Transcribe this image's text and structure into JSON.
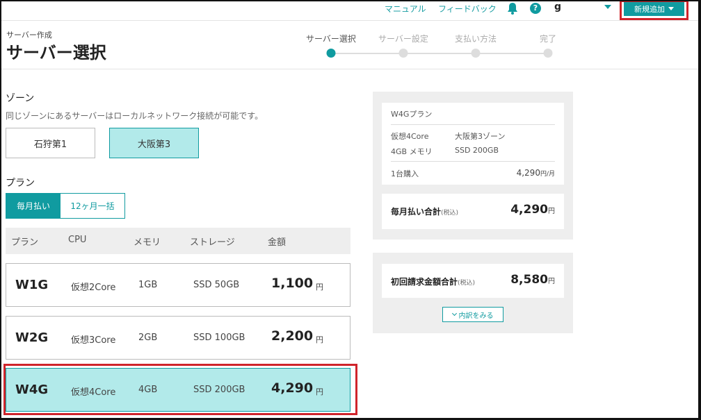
{
  "topbar": {
    "manual": "マニュアル",
    "feedback": "フィードバック",
    "help_glyph": "?",
    "user": "g",
    "new_button": "新規追加"
  },
  "header": {
    "breadcrumb": "サーバー作成",
    "title": "サーバー選択",
    "steps": [
      {
        "label": "サーバー選択",
        "active": true
      },
      {
        "label": "サーバー設定",
        "active": false
      },
      {
        "label": "支払い方法",
        "active": false
      },
      {
        "label": "完了",
        "active": false
      }
    ]
  },
  "zone": {
    "title": "ゾーン",
    "description": "同じゾーンにあるサーバーはローカルネットワーク接続が可能です。",
    "options": [
      "石狩第1",
      "大阪第3"
    ],
    "selected": "大阪第3"
  },
  "plan": {
    "title": "プラン",
    "billing_options": [
      "毎月払い",
      "12ヶ月一括"
    ],
    "billing_selected": "毎月払い",
    "columns": [
      "プラン",
      "CPU",
      "メモリ",
      "ストレージ",
      "金額"
    ],
    "rows": [
      {
        "name": "W1G",
        "cpu": "仮想2Core",
        "memory": "1GB",
        "storage": "SSD 50GB",
        "price": "1,100",
        "unit": "円"
      },
      {
        "name": "W2G",
        "cpu": "仮想3Core",
        "memory": "2GB",
        "storage": "SSD 100GB",
        "price": "2,200",
        "unit": "円"
      },
      {
        "name": "W4G",
        "cpu": "仮想4Core",
        "memory": "4GB",
        "storage": "SSD 200GB",
        "price": "4,290",
        "unit": "円"
      }
    ],
    "selected": "W4G"
  },
  "summary": {
    "plan_name": "W4Gプラン",
    "cpu": "仮想4Core",
    "zone": "大阪第3ゾーン",
    "memory": "4GB メモリ",
    "storage": "SSD 200GB",
    "quantity": "1台購入",
    "unit_price": "4,290",
    "unit_price_suffix": "円/月",
    "monthly_total_label": "毎月払い合計",
    "tax_label": "(税込)",
    "monthly_total": "4,290",
    "yen": "円"
  },
  "initial": {
    "label": "初回請求金額合計",
    "tax_label": "(税込)",
    "total": "8,580",
    "yen": "円",
    "breakdown_button": "内訳をみる"
  },
  "colors": {
    "accent": "#109ba0",
    "selected_bg": "#b2eaea",
    "highlight_box": "#d0242b"
  }
}
